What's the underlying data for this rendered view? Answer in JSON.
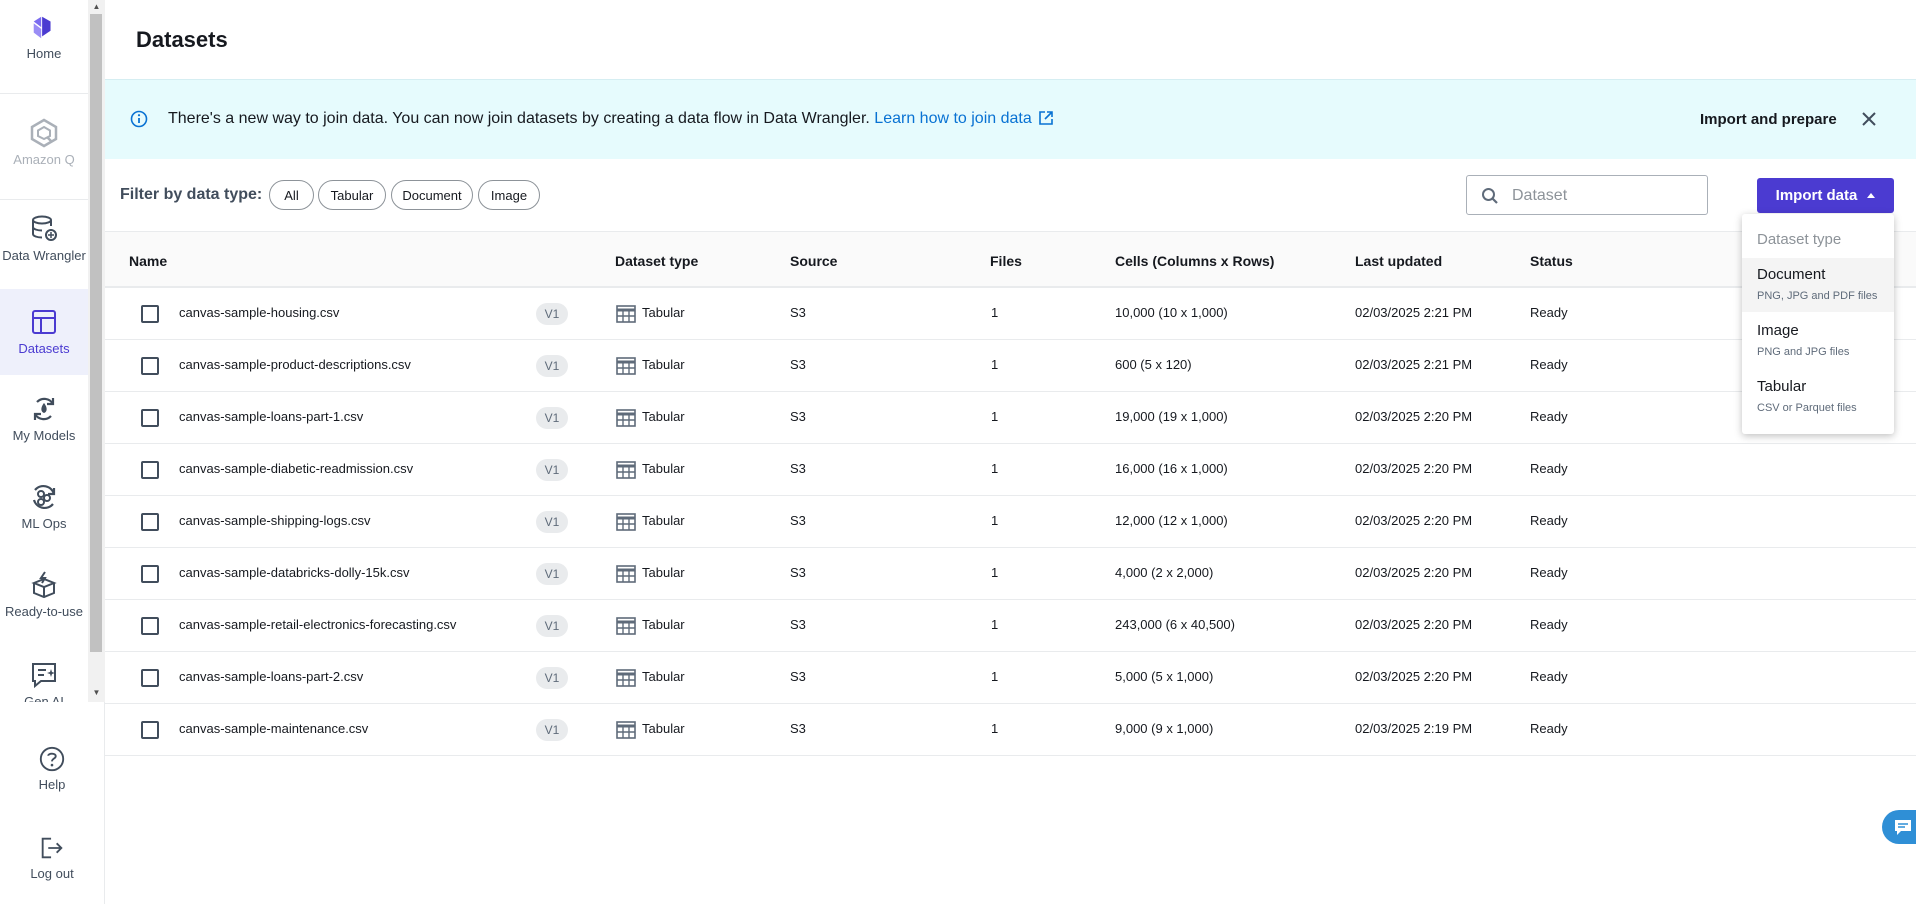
{
  "sidebar": {
    "items": [
      {
        "label": "Home",
        "icon": "home-logo-icon"
      },
      {
        "label": "Amazon Q",
        "icon": "amazon-q-icon"
      },
      {
        "label": "Data Wrangler",
        "icon": "data-wrangler-icon"
      },
      {
        "label": "Datasets",
        "icon": "datasets-icon"
      },
      {
        "label": "My Models",
        "icon": "my-models-icon"
      },
      {
        "label": "ML Ops",
        "icon": "ml-ops-icon"
      },
      {
        "label": "Ready-to-use",
        "icon": "ready-to-use-icon"
      },
      {
        "label": "Gen AI",
        "icon": "gen-ai-icon"
      }
    ],
    "help_label": "Help",
    "logout_label": "Log out"
  },
  "page": {
    "title": "Datasets"
  },
  "banner": {
    "message": "There's a new way to join data. You can now join datasets by creating a data flow in Data Wrangler. ",
    "link_text": "Learn how to join data",
    "action_label": "Import and prepare"
  },
  "filter": {
    "label": "Filter by data type:",
    "chips": [
      "All",
      "Tabular",
      "Document",
      "Image"
    ]
  },
  "search": {
    "placeholder": "Dataset"
  },
  "import_button": {
    "label": "Import data"
  },
  "table": {
    "columns": [
      "Name",
      "Dataset type",
      "Source",
      "Files",
      "Cells (Columns x Rows)",
      "Last updated",
      "Status"
    ],
    "rows": [
      {
        "name": "canvas-sample-housing.csv",
        "version": "V1",
        "type": "Tabular",
        "source": "S3",
        "files": "1",
        "cells": "10,000 (10 x 1,000)",
        "updated": "02/03/2025 2:21 PM",
        "status": "Ready"
      },
      {
        "name": "canvas-sample-product-descriptions.csv",
        "version": "V1",
        "type": "Tabular",
        "source": "S3",
        "files": "1",
        "cells": "600 (5 x 120)",
        "updated": "02/03/2025 2:21 PM",
        "status": "Ready"
      },
      {
        "name": "canvas-sample-loans-part-1.csv",
        "version": "V1",
        "type": "Tabular",
        "source": "S3",
        "files": "1",
        "cells": "19,000 (19 x 1,000)",
        "updated": "02/03/2025 2:20 PM",
        "status": "Ready"
      },
      {
        "name": "canvas-sample-diabetic-readmission.csv",
        "version": "V1",
        "type": "Tabular",
        "source": "S3",
        "files": "1",
        "cells": "16,000 (16 x 1,000)",
        "updated": "02/03/2025 2:20 PM",
        "status": "Ready"
      },
      {
        "name": "canvas-sample-shipping-logs.csv",
        "version": "V1",
        "type": "Tabular",
        "source": "S3",
        "files": "1",
        "cells": "12,000 (12 x 1,000)",
        "updated": "02/03/2025 2:20 PM",
        "status": "Ready"
      },
      {
        "name": "canvas-sample-databricks-dolly-15k.csv",
        "version": "V1",
        "type": "Tabular",
        "source": "S3",
        "files": "1",
        "cells": "4,000 (2 x 2,000)",
        "updated": "02/03/2025 2:20 PM",
        "status": "Ready"
      },
      {
        "name": "canvas-sample-retail-electronics-forecasting.csv",
        "version": "V1",
        "type": "Tabular",
        "source": "S3",
        "files": "1",
        "cells": "243,000 (6 x 40,500)",
        "updated": "02/03/2025 2:20 PM",
        "status": "Ready"
      },
      {
        "name": "canvas-sample-loans-part-2.csv",
        "version": "V1",
        "type": "Tabular",
        "source": "S3",
        "files": "1",
        "cells": "5,000 (5 x 1,000)",
        "updated": "02/03/2025 2:20 PM",
        "status": "Ready"
      },
      {
        "name": "canvas-sample-maintenance.csv",
        "version": "V1",
        "type": "Tabular",
        "source": "S3",
        "files": "1",
        "cells": "9,000 (9 x 1,000)",
        "updated": "02/03/2025 2:19 PM",
        "status": "Ready"
      }
    ]
  },
  "dropdown": {
    "header": "Dataset type",
    "items": [
      {
        "title": "Document",
        "desc": "PNG, JPG and PDF files"
      },
      {
        "title": "Image",
        "desc": "PNG and JPG files"
      },
      {
        "title": "Tabular",
        "desc": "CSV or Parquet files"
      }
    ]
  },
  "colors": {
    "accent": "#4b3bd1",
    "banner_bg": "#e6fbfd",
    "link": "#0972d3"
  }
}
